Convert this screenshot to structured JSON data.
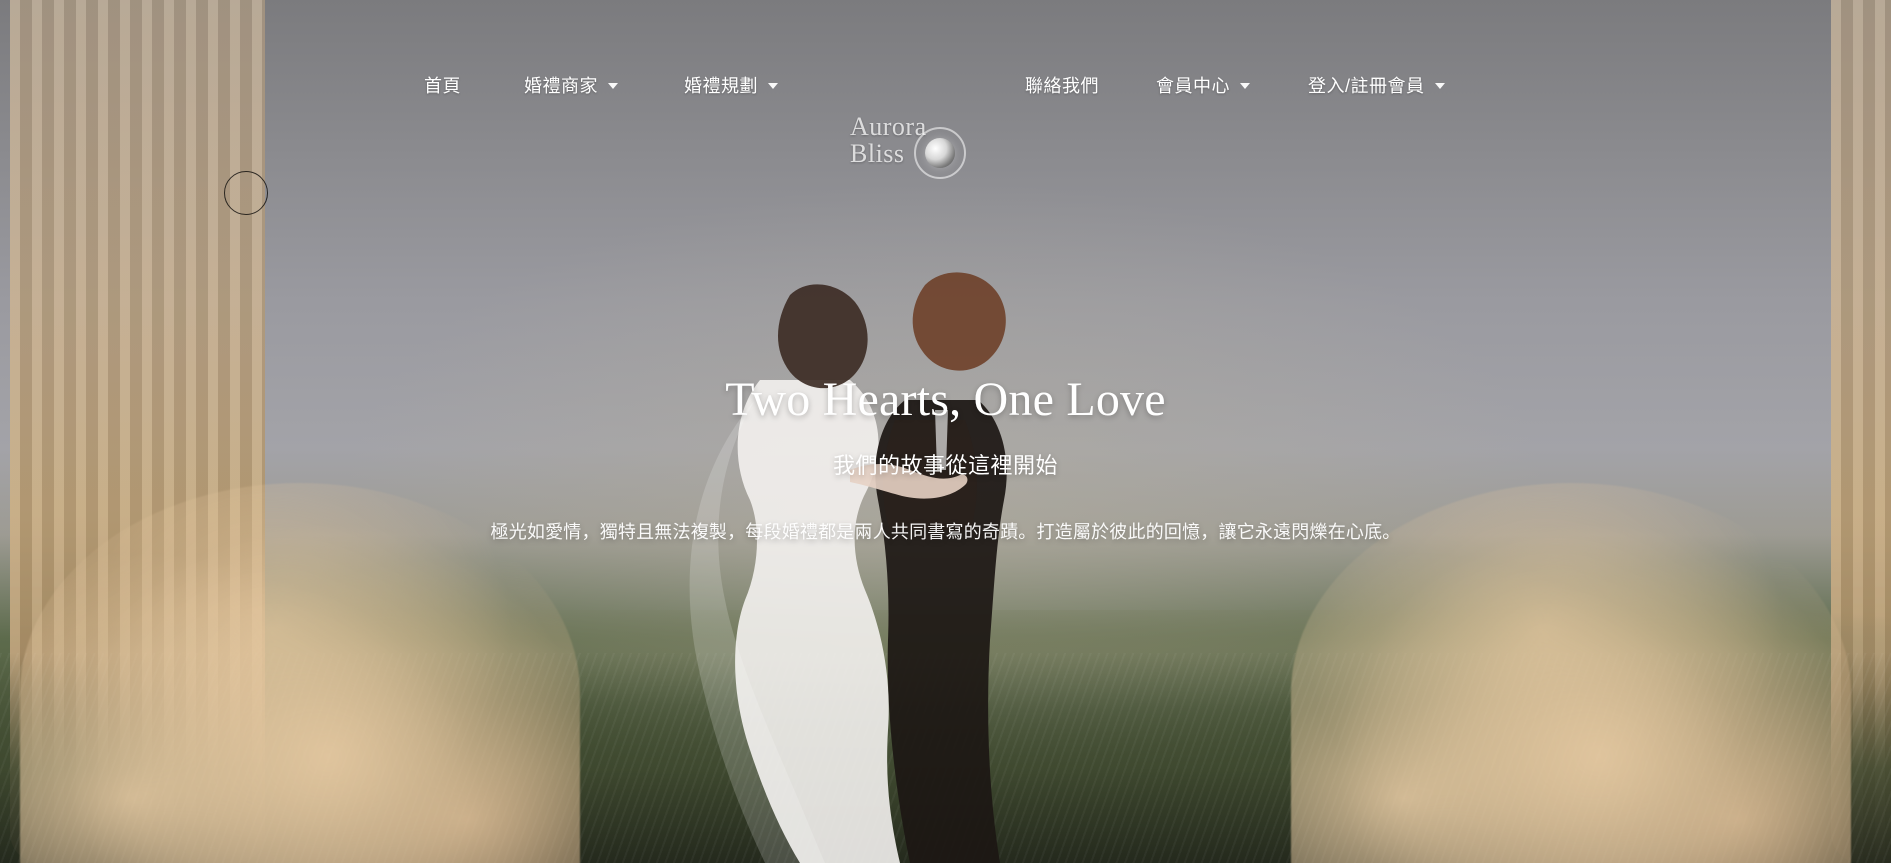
{
  "nav": {
    "home": "首頁",
    "wedding_vendors": "婚禮商家",
    "wedding_planning": "婚禮規劃",
    "contact": "聯絡我們",
    "member_center": "會員中心",
    "login_register": "登入/註冊會員"
  },
  "logo": {
    "text": "Aurora\nBliss"
  },
  "hero": {
    "title": "Two Hearts, One Love",
    "subtitle": "我們的故事從這裡開始",
    "description": "極光如愛情，獨特且無法複製，每段婚禮都是兩人共同書寫的奇蹟。打造屬於彼此的回憶，讓它永遠閃爍在心底。"
  },
  "icons": {
    "caret": "caret-down-icon",
    "moon": "moon-icon",
    "cursor": "cursor-ring"
  },
  "colors": {
    "text": "#ffffff"
  }
}
